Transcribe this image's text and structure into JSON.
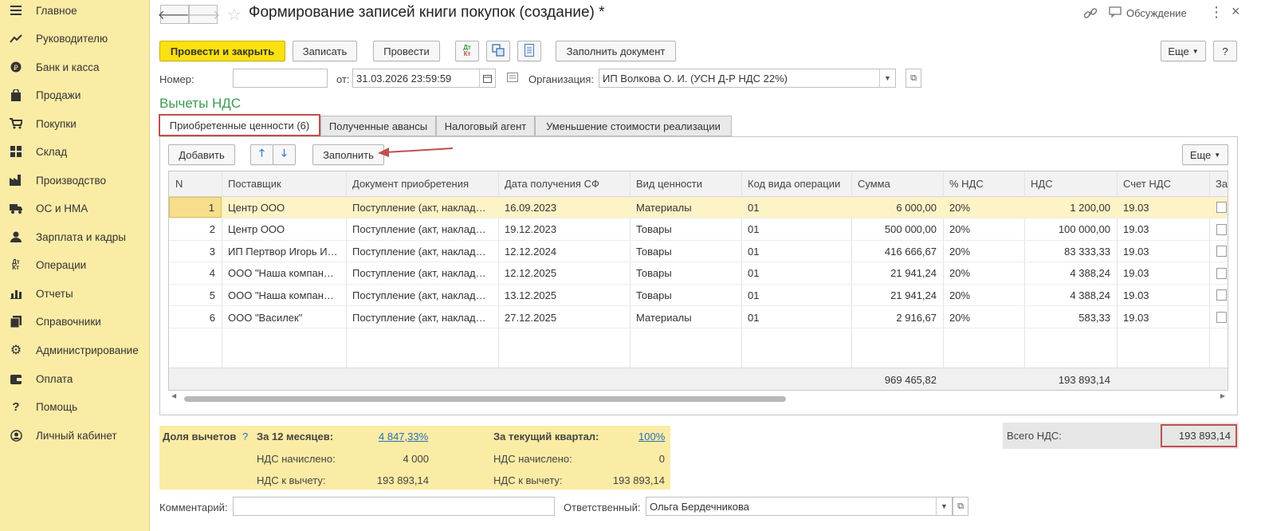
{
  "sidebar": {
    "items": [
      {
        "label": "Главное",
        "icon": "menu-icon"
      },
      {
        "label": "Руководителю",
        "icon": "trend-icon"
      },
      {
        "label": "Банк и касса",
        "icon": "coin-icon"
      },
      {
        "label": "Продажи",
        "icon": "bag-icon"
      },
      {
        "label": "Покупки",
        "icon": "cart-icon"
      },
      {
        "label": "Склад",
        "icon": "warehouse-icon"
      },
      {
        "label": "Производство",
        "icon": "factory-icon"
      },
      {
        "label": "ОС и НМА",
        "icon": "truck-icon"
      },
      {
        "label": "Зарплата и кадры",
        "icon": "person-icon"
      },
      {
        "label": "Операции",
        "icon": "dt-kt-icon"
      },
      {
        "label": "Отчеты",
        "icon": "bar-chart-icon"
      },
      {
        "label": "Справочники",
        "icon": "books-icon"
      },
      {
        "label": "Администрирование",
        "icon": "gear-icon"
      },
      {
        "label": "Оплата",
        "icon": "wallet-icon"
      },
      {
        "label": "Помощь",
        "icon": "question-icon"
      },
      {
        "label": "Личный кабинет",
        "icon": "user-circle-icon"
      }
    ]
  },
  "header": {
    "title": "Формирование записей книги покупок (создание) *",
    "discussion": "Обсуждение"
  },
  "toolbar": {
    "post_close": "Провести и закрыть",
    "save": "Записать",
    "post": "Провести",
    "fill_doc": "Заполнить документ",
    "more": "Еще",
    "help": "?"
  },
  "form": {
    "number_label": "Номер:",
    "number_value": "",
    "date_label": "от:",
    "date_value": "31.03.2026 23:59:59",
    "org_label": "Организация:",
    "org_value": "ИП Волкова О. И. (УСН Д-Р НДС 22%)"
  },
  "section_title": "Вычеты НДС",
  "tabs": [
    {
      "label": "Приобретенные ценности (6)"
    },
    {
      "label": "Полученные авансы"
    },
    {
      "label": "Налоговый агент"
    },
    {
      "label": "Уменьшение стоимости реализации"
    }
  ],
  "table_toolbar": {
    "add": "Добавить",
    "fill": "Заполнить",
    "more": "Еще"
  },
  "table": {
    "columns": [
      "N",
      "Поставщик",
      "Документ приобретения",
      "Дата получения СФ",
      "Вид ценности",
      "Код вида операции",
      "Сумма",
      "% НДС",
      "НДС",
      "Счет НДС",
      "За"
    ],
    "rows": [
      {
        "n": "1",
        "supplier": "Центр ООО",
        "doc": "Поступление (акт, наклад…",
        "date": "16.09.2023",
        "kind": "Материалы",
        "code": "01",
        "sum": "6 000,00",
        "rate": "20%",
        "vat": "1 200,00",
        "account": "19.03"
      },
      {
        "n": "2",
        "supplier": "Центр ООО",
        "doc": "Поступление (акт, наклад…",
        "date": "19.12.2023",
        "kind": "Товары",
        "code": "01",
        "sum": "500 000,00",
        "rate": "20%",
        "vat": "100 000,00",
        "account": "19.03"
      },
      {
        "n": "3",
        "supplier": "ИП Пертвор Игорь И…",
        "doc": "Поступление (акт, наклад…",
        "date": "12.12.2024",
        "kind": "Товары",
        "code": "01",
        "sum": "416 666,67",
        "rate": "20%",
        "vat": "83 333,33",
        "account": "19.03"
      },
      {
        "n": "4",
        "supplier": "ООО \"Наша компан…",
        "doc": "Поступление (акт, наклад…",
        "date": "12.12.2025",
        "kind": "Товары",
        "code": "01",
        "sum": "21 941,24",
        "rate": "20%",
        "vat": "4 388,24",
        "account": "19.03"
      },
      {
        "n": "5",
        "supplier": "ООО \"Наша компан…",
        "doc": "Поступление (акт, наклад…",
        "date": "13.12.2025",
        "kind": "Товары",
        "code": "01",
        "sum": "21 941,24",
        "rate": "20%",
        "vat": "4 388,24",
        "account": "19.03"
      },
      {
        "n": "6",
        "supplier": "ООО \"Василек\"",
        "doc": "Поступление (акт, наклад…",
        "date": "27.12.2025",
        "kind": "Материалы",
        "code": "01",
        "sum": "2 916,67",
        "rate": "20%",
        "vat": "583,33",
        "account": "19.03"
      }
    ],
    "total_sum": "969 465,82",
    "total_vat": "193 893,14"
  },
  "summary": {
    "share_label": "Доля вычетов",
    "help": "?",
    "months12_label": "За 12 месяцев:",
    "months12_value": "4 847,33%",
    "quarter_label": "За текущий квартал:",
    "quarter_value": "100%",
    "accrued_label": "НДС начислено:",
    "accrued_12": "4 000",
    "accrued_q": "0",
    "deduct_label": "НДС к вычету:",
    "deduct_12": "193 893,14",
    "deduct_q": "193 893,14"
  },
  "total_vat": {
    "label": "Всего НДС:",
    "value": "193 893,14"
  },
  "comment": {
    "label": "Комментарий:",
    "value": ""
  },
  "responsible": {
    "label": "Ответственный:",
    "value": "Ольга Бердечникова"
  },
  "colors": {
    "sidebar_bg": "#fbeca5",
    "primary_btn": "#fbe10f",
    "section_title": "#3f9a54",
    "highlight_border": "#c0504d"
  }
}
